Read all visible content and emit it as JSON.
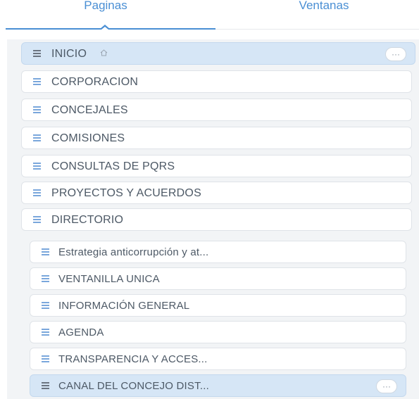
{
  "tabs": {
    "paginas": "Paginas",
    "ventanas": "Ventanas"
  },
  "colors": {
    "accent": "#4a8fd4",
    "selected_bg": "#d6e6f6",
    "item_bg": "#ffffff",
    "list_bg": "#f2f4f6"
  },
  "pages": [
    {
      "label": "INICIO",
      "icon": "list-icon",
      "home": true,
      "selected": true,
      "more": "···"
    },
    {
      "label": "CORPORACION",
      "icon": "list-icon"
    },
    {
      "label": "CONCEJALES",
      "icon": "list-icon"
    },
    {
      "label": "COMISIONES",
      "icon": "list-icon"
    },
    {
      "label": "CONSULTAS DE PQRS",
      "icon": "list-icon"
    },
    {
      "label": "PROYECTOS Y ACUERDOS",
      "icon": "list-icon"
    },
    {
      "label": "DIRECTORIO",
      "icon": "list-icon"
    },
    {
      "label": "Estrategia anticorrupción y at...",
      "icon": "list-icon"
    },
    {
      "label": "VENTANILLA UNICA",
      "icon": "list-icon"
    },
    {
      "label": "INFORMACIÓN GENERAL",
      "icon": "list-icon"
    },
    {
      "label": "AGENDA",
      "icon": "list-icon"
    },
    {
      "label": "TRANSPARENCIA Y ACCES...",
      "icon": "list-icon"
    },
    {
      "label": "CANAL DEL CONCEJO DIST...",
      "icon": "list-icon",
      "selected": true,
      "more": "···"
    }
  ]
}
